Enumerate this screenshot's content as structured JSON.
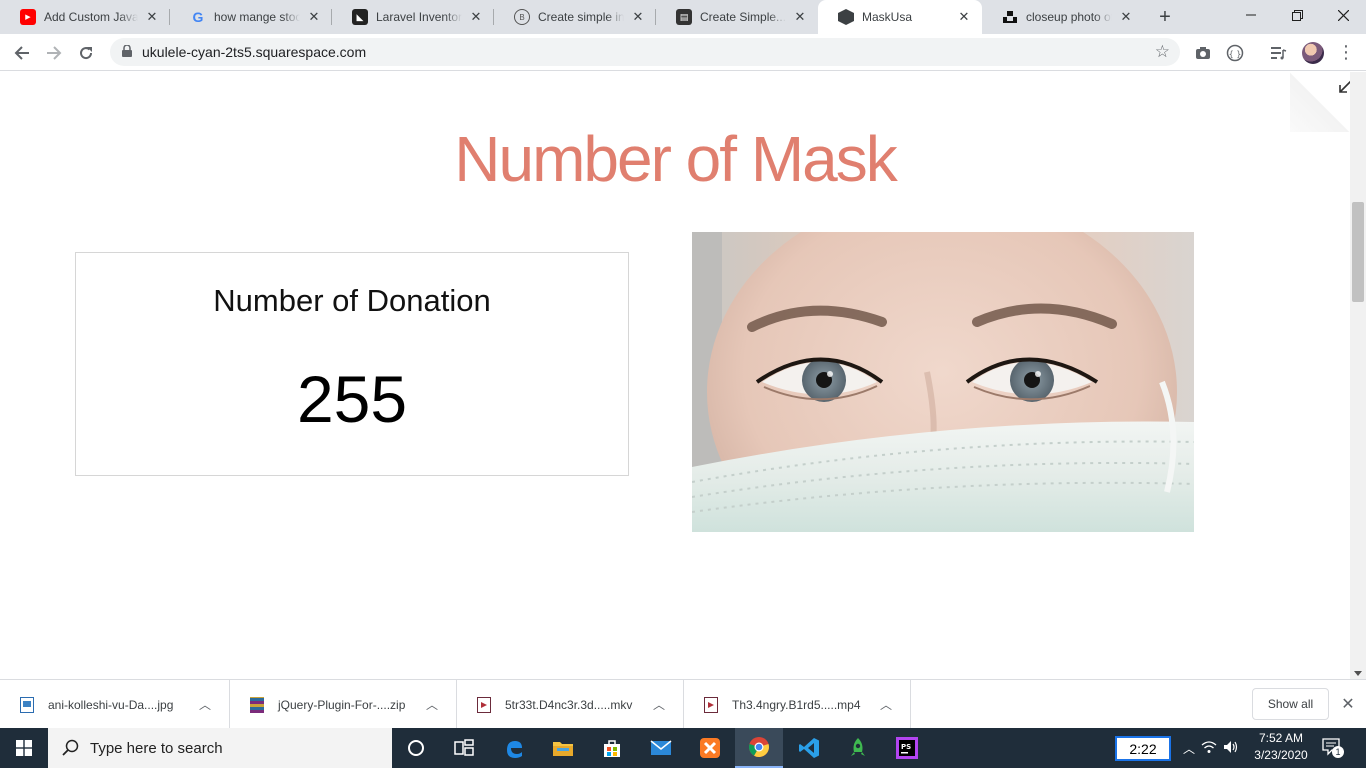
{
  "browser": {
    "tabs": [
      {
        "title": "Add Custom JavaScript",
        "favicon": "youtube-icon",
        "active": false
      },
      {
        "title": "how mange stock",
        "favicon": "google-icon",
        "active": false
      },
      {
        "title": "Laravel Inventory Management",
        "favicon": "laravel-icon",
        "active": false
      },
      {
        "title": "Create simple inventory",
        "favicon": "site-icon",
        "active": false
      },
      {
        "title": "Create Simple... by",
        "favicon": "book-icon",
        "active": false
      },
      {
        "title": "MaskUsa",
        "favicon": "squarespace-icon",
        "active": true
      },
      {
        "title": "closeup photo of woman",
        "favicon": "unsplash-icon",
        "active": false
      }
    ],
    "new_tab": "+",
    "url": "ukulele-cyan-2ts5.squarespace.com"
  },
  "page": {
    "heading": "Number of Mask",
    "card": {
      "label": "Number of Donation",
      "count": "255"
    },
    "image_alt": "closeup photo of woman wearing surgical mask"
  },
  "downloads": {
    "items": [
      {
        "name": "ani-kolleshi-vu-Da....jpg",
        "icon": "image-file-icon"
      },
      {
        "name": "jQuery-Plugin-For-....zip",
        "icon": "zip-file-icon"
      },
      {
        "name": "5tr33t.D4nc3r.3d.....mkv",
        "icon": "video-file-icon"
      },
      {
        "name": "Th3.4ngry.B1rd5.....mp4",
        "icon": "video-file-icon"
      }
    ],
    "show_all": "Show all"
  },
  "taskbar": {
    "search_placeholder": "Type here to search",
    "timer": "2:22",
    "time": "7:52 AM",
    "date": "3/23/2020",
    "notification_count": "1"
  },
  "colors": {
    "heading": "#e07f6f",
    "taskbar": "#1f2d3a",
    "tab_strip": "#dee1e6"
  }
}
